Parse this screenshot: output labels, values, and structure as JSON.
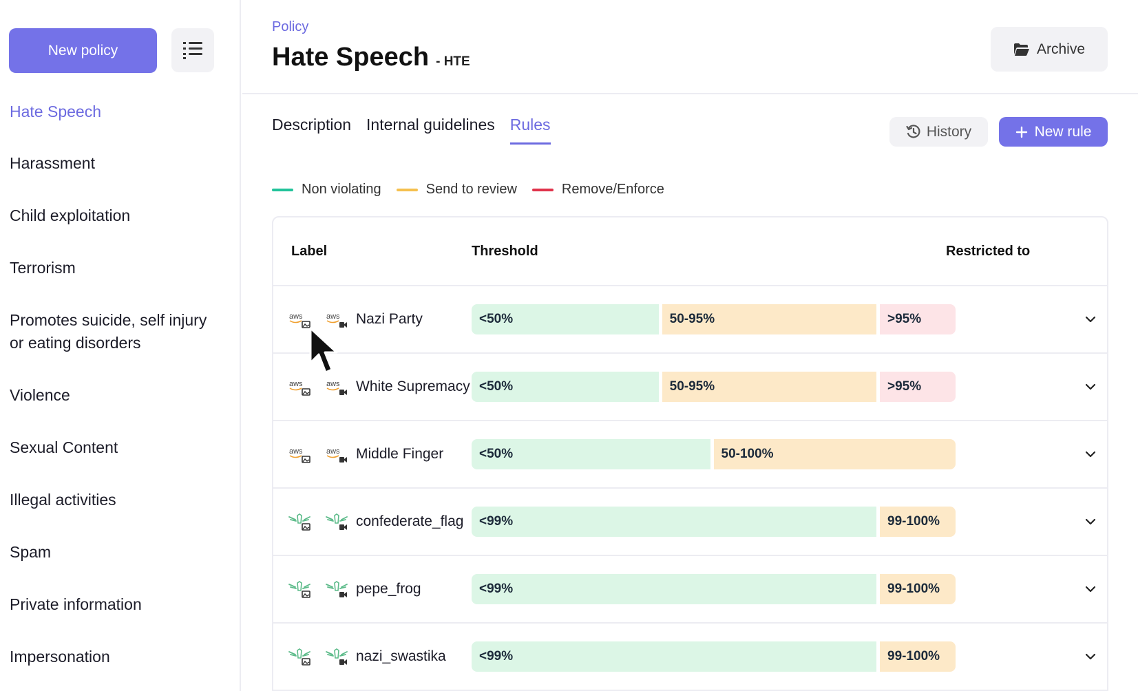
{
  "sidebar": {
    "new_policy_label": "New policy",
    "items": [
      {
        "label": "Hate Speech",
        "active": true
      },
      {
        "label": "Harassment"
      },
      {
        "label": "Child exploitation"
      },
      {
        "label": "Terrorism"
      },
      {
        "label": "Promotes suicide, self injury",
        "label2": "or eating disorders"
      },
      {
        "label": "Violence"
      },
      {
        "label": "Sexual Content"
      },
      {
        "label": "Illegal activities"
      },
      {
        "label": "Spam"
      },
      {
        "label": "Private information"
      },
      {
        "label": "Impersonation"
      }
    ]
  },
  "header": {
    "breadcrumb": "Policy",
    "title": "Hate Speech",
    "code": "- HTE",
    "archive_label": "Archive"
  },
  "tabs": [
    {
      "label": "Description"
    },
    {
      "label": "Internal guidelines"
    },
    {
      "label": "Rules",
      "active": true
    }
  ],
  "actions": {
    "history_label": "History",
    "new_rule_label": "New rule"
  },
  "legend": [
    {
      "label": "Non violating",
      "color": "#22c39a"
    },
    {
      "label": "Send to review",
      "color": "#f5c04e"
    },
    {
      "label": "Remove/Enforce",
      "color": "#e0334b"
    }
  ],
  "table": {
    "columns": {
      "label": "Label",
      "threshold": "Threshold",
      "restricted": "Restricted to"
    },
    "rows": [
      {
        "name": "Nazi Party",
        "source": "aws",
        "segments": [
          {
            "text": "<50%",
            "kind": "green",
            "share": 0.5
          },
          {
            "text": "50-95%",
            "kind": "amber",
            "share": 0.45
          },
          {
            "text": ">95%",
            "kind": "red",
            "share": 0.05
          }
        ]
      },
      {
        "name": "White Supremacy",
        "source": "aws",
        "segments": [
          {
            "text": "<50%",
            "kind": "green",
            "share": 0.5
          },
          {
            "text": "50-95%",
            "kind": "amber",
            "share": 0.45
          },
          {
            "text": ">95%",
            "kind": "red",
            "share": 0.05
          }
        ]
      },
      {
        "name": "Middle Finger",
        "source": "aws",
        "segments": [
          {
            "text": "<50%",
            "kind": "green",
            "share": 0.5
          },
          {
            "text": "50-100%",
            "kind": "amber",
            "share": 0.5
          }
        ]
      },
      {
        "name": "confederate_flag",
        "source": "wing",
        "segments": [
          {
            "text": "<99%",
            "kind": "green",
            "share": 0.99
          },
          {
            "text": "99-100%",
            "kind": "amber",
            "share": 0.01
          }
        ]
      },
      {
        "name": "pepe_frog",
        "source": "wing",
        "segments": [
          {
            "text": "<99%",
            "kind": "green",
            "share": 0.99
          },
          {
            "text": "99-100%",
            "kind": "amber",
            "share": 0.01
          }
        ]
      },
      {
        "name": "nazi_swastika",
        "source": "wing",
        "segments": [
          {
            "text": "<99%",
            "kind": "green",
            "share": 0.99
          },
          {
            "text": "99-100%",
            "kind": "amber",
            "share": 0.01
          }
        ]
      }
    ]
  },
  "icons": {
    "list": "list-icon",
    "archive": "folder-open-icon",
    "history": "history-icon",
    "new_rule": "plus-icon",
    "aws_image": "aws-image-icon",
    "aws_video": "aws-video-icon",
    "wing_image": "wing-image-icon",
    "wing_video": "wing-video-icon",
    "expand": "chevron-down-icon"
  }
}
